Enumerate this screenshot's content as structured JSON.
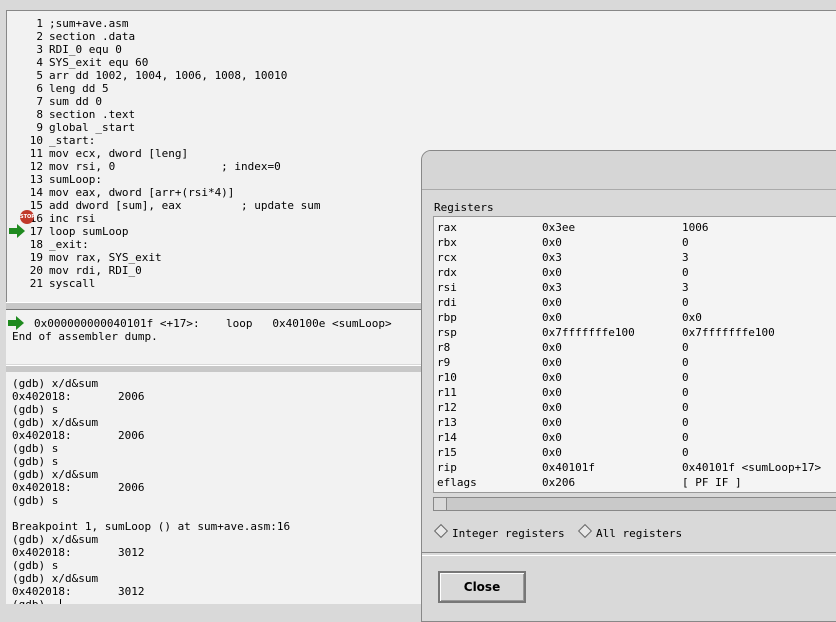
{
  "source": {
    "lines": [
      {
        "num": "1",
        "code": ";sum+ave.asm"
      },
      {
        "num": "2",
        "code": "section .data"
      },
      {
        "num": "3",
        "code": "RDI_0 equ 0"
      },
      {
        "num": "4",
        "code": "SYS_exit equ 60"
      },
      {
        "num": "5",
        "code": "arr dd 1002, 1004, 1006, 1008, 10010"
      },
      {
        "num": "6",
        "code": "leng dd 5"
      },
      {
        "num": "7",
        "code": "sum dd 0"
      },
      {
        "num": "8",
        "code": "section .text"
      },
      {
        "num": "9",
        "code": "global _start"
      },
      {
        "num": "10",
        "code": "_start:"
      },
      {
        "num": "11",
        "code": "mov ecx, dword [leng]"
      },
      {
        "num": "12",
        "code": "mov rsi, 0                ; index=0"
      },
      {
        "num": "13",
        "code": "sumLoop:"
      },
      {
        "num": "14",
        "code": "mov eax, dword [arr+(rsi*4)]"
      },
      {
        "num": "15",
        "code": "add dword [sum], eax         ; update sum"
      },
      {
        "num": "16",
        "code": "inc rsi"
      },
      {
        "num": "17",
        "code": "loop sumLoop"
      },
      {
        "num": "18",
        "code": "_exit:"
      },
      {
        "num": "19",
        "code": "mov rax, SYS_exit"
      },
      {
        "num": "20",
        "code": "mov rdi, RDI_0"
      },
      {
        "num": "21",
        "code": "syscall"
      }
    ],
    "breakpoint_label": "STOP"
  },
  "asm": {
    "line1": "0x000000000040101f <+17>:    loop   0x40100e <sumLoop>",
    "line2": "End of assembler dump."
  },
  "console": {
    "lines": [
      "(gdb) x/d&sum",
      "0x402018:       2006",
      "(gdb) s",
      "(gdb) x/d&sum",
      "0x402018:       2006",
      "(gdb) s",
      "(gdb) s",
      "(gdb) x/d&sum",
      "0x402018:       2006",
      "(gdb) s",
      "",
      "Breakpoint 1, sumLoop () at sum+ave.asm:16",
      "(gdb) x/d&sum",
      "0x402018:       3012",
      "(gdb) s",
      "(gdb) x/d&sum",
      "0x402018:       3012",
      "(gdb) "
    ]
  },
  "registers": {
    "title": "Registers",
    "rows": [
      {
        "name": "rax",
        "hex": "0x3ee",
        "natural": "1006"
      },
      {
        "name": "rbx",
        "hex": "0x0",
        "natural": "0"
      },
      {
        "name": "rcx",
        "hex": "0x3",
        "natural": "3"
      },
      {
        "name": "rdx",
        "hex": "0x0",
        "natural": "0"
      },
      {
        "name": "rsi",
        "hex": "0x3",
        "natural": "3"
      },
      {
        "name": "rdi",
        "hex": "0x0",
        "natural": "0"
      },
      {
        "name": "rbp",
        "hex": "0x0",
        "natural": "0x0"
      },
      {
        "name": "rsp",
        "hex": "0x7fffffffe100",
        "natural": "0x7fffffffe100"
      },
      {
        "name": "r8",
        "hex": "0x0",
        "natural": "0"
      },
      {
        "name": "r9",
        "hex": "0x0",
        "natural": "0"
      },
      {
        "name": "r10",
        "hex": "0x0",
        "natural": "0"
      },
      {
        "name": "r11",
        "hex": "0x0",
        "natural": "0"
      },
      {
        "name": "r12",
        "hex": "0x0",
        "natural": "0"
      },
      {
        "name": "r13",
        "hex": "0x0",
        "natural": "0"
      },
      {
        "name": "r14",
        "hex": "0x0",
        "natural": "0"
      },
      {
        "name": "r15",
        "hex": "0x0",
        "natural": "0"
      },
      {
        "name": "rip",
        "hex": "0x40101f",
        "natural": "0x40101f <sumLoop+17>"
      },
      {
        "name": "eflags",
        "hex": "0x206",
        "natural": "[ PF IF ]"
      }
    ],
    "radio_integer": "Integer registers",
    "radio_all": "All registers",
    "close_label": "Close"
  },
  "colors": {
    "arrow": "#1f8a1f",
    "stop": "#c0392b"
  }
}
